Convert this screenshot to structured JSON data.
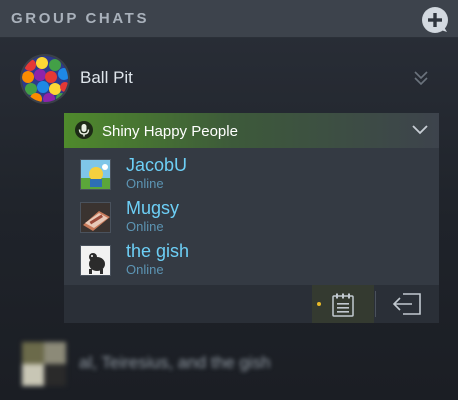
{
  "header": {
    "title": "GROUP CHATS",
    "add_icon": "plus-circle-icon"
  },
  "group": {
    "name": "Ball Pit",
    "avatar_icon": "colorful-balls-avatar",
    "collapse_icon": "double-chevron-down-icon"
  },
  "voice_channel": {
    "name": "Shiny Happy People",
    "icon": "voice-mic-icon",
    "chevron_icon": "chevron-down-icon",
    "accent_color": "#4f8a2c",
    "members": [
      {
        "name": "JacobU",
        "status": "Online",
        "avatar": "jacobu-avatar"
      },
      {
        "name": "Mugsy",
        "status": "Online",
        "avatar": "mugsy-avatar"
      },
      {
        "name": "the gish",
        "status": "Online",
        "avatar": "the-gish-avatar"
      }
    ],
    "actions": {
      "notes_icon": "clipboard-icon",
      "leave_icon": "leave-voice-icon",
      "notification_dot_color": "#e8b929"
    }
  },
  "recent_group": {
    "name": "al, Teiresius, and the gish",
    "avatar_icon": "group-collage-avatar"
  },
  "colors": {
    "member_name": "#6dcff6",
    "member_status": "#5c94b3",
    "header_bg": "#3d434c"
  }
}
